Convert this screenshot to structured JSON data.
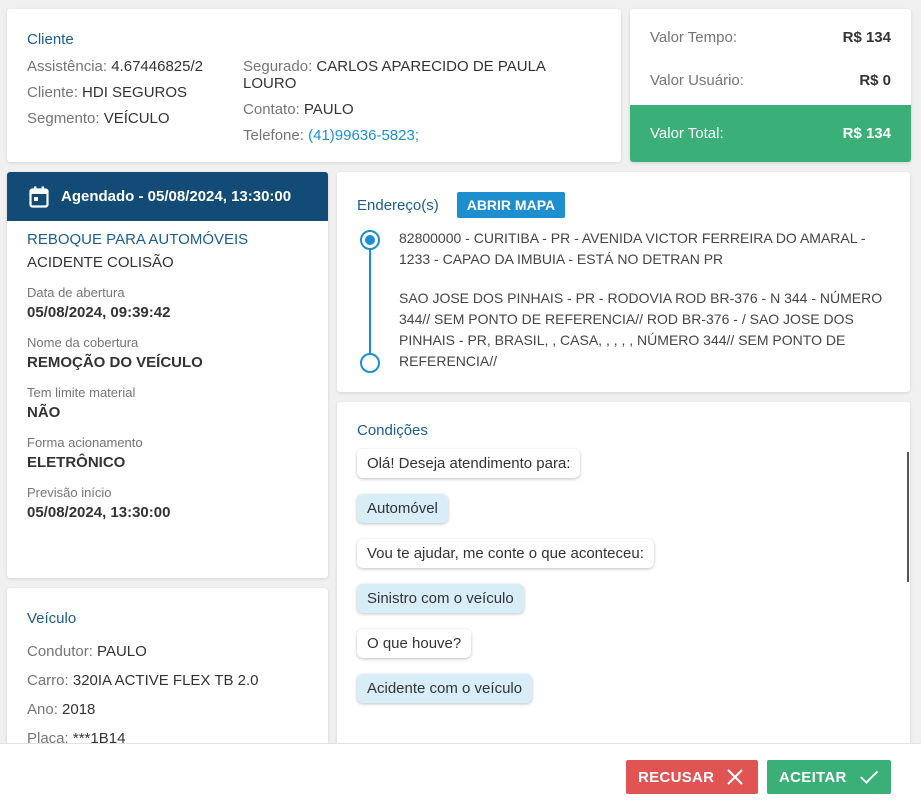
{
  "cliente": {
    "title": "Cliente",
    "assistencia_label": "Assistência:",
    "assistencia": "4.67446825/2",
    "cliente_label": "Cliente:",
    "cliente": "HDI SEGUROS",
    "segmento_label": "Segmento:",
    "segmento": "VEÍCULO",
    "segurado_label": "Segurado:",
    "segurado": "CARLOS APARECIDO DE PAULA LOURO",
    "contato_label": "Contato:",
    "contato": "PAULO",
    "telefone_label": "Telefone:",
    "telefone": "(41)99636-5823;"
  },
  "valor": {
    "tempo_label": "Valor Tempo:",
    "tempo": "R$ 134",
    "usuario_label": "Valor Usuário:",
    "usuario": "R$ 0",
    "total_label": "Valor Total:",
    "total": "R$ 134",
    "total_color": "#3aaf78"
  },
  "agendamento": {
    "header": "Agendado - 05/08/2024, 13:30:00",
    "header_icon": "calendar-icon",
    "header_color": "#124b75",
    "servico": "REBOQUE PARA AUTOMÓVEIS",
    "motivo": "ACIDENTE COLISÃO",
    "fields": [
      {
        "label": "Data de abertura",
        "value": "05/08/2024, 09:39:42"
      },
      {
        "label": "Nome da cobertura",
        "value": "REMOÇÃO DO VEÍCULO"
      },
      {
        "label": "Tem limite material",
        "value": "NÃO"
      },
      {
        "label": "Forma acionamento",
        "value": "ELETRÔNICO"
      },
      {
        "label": "Previsão início",
        "value": "05/08/2024, 13:30:00"
      }
    ]
  },
  "veiculo": {
    "title": "Veículo",
    "condutor_label": "Condutor:",
    "condutor": "PAULO",
    "carro_label": "Carro:",
    "carro": "320IA ACTIVE FLEX TB 2.0",
    "ano_label": "Ano:",
    "ano": "2018",
    "placa_label": "Placa:",
    "placa": "***1B14"
  },
  "endereco": {
    "title": "Endereço(s)",
    "map_button": "ABRIR MAPA",
    "origem": "82800000 - CURITIBA - PR - AVENIDA VICTOR FERREIRA DO AMARAL - 1233 - CAPAO DA IMBUIA - ESTÁ NO DETRAN PR",
    "destino": "SAO JOSE DOS PINHAIS - PR - RODOVIA ROD BR-376 - N 344 - NÚMERO 344// SEM PONTO DE REFERENCIA// ROD BR-376 - / SAO JOSE DOS PINHAIS - PR, BRASIL, , CASA, , , , , NÚMERO 344// SEM PONTO DE REFERENCIA//"
  },
  "condicoes": {
    "title": "Condições",
    "messages": [
      {
        "from": "bot",
        "text": "Olá! Deseja atendimento para:"
      },
      {
        "from": "user",
        "text": "Automóvel"
      },
      {
        "from": "bot",
        "text": "Vou te ajudar, me conte o que aconteceu:"
      },
      {
        "from": "user",
        "text": "Sinistro com o veículo"
      },
      {
        "from": "bot",
        "text": "O que houve?"
      },
      {
        "from": "user",
        "text": "Acidente com o veículo"
      }
    ]
  },
  "footer": {
    "recusar": "RECUSAR",
    "recusar_color": "#e05454",
    "aceitar": "ACEITAR",
    "aceitar_color": "#3aaf78"
  }
}
